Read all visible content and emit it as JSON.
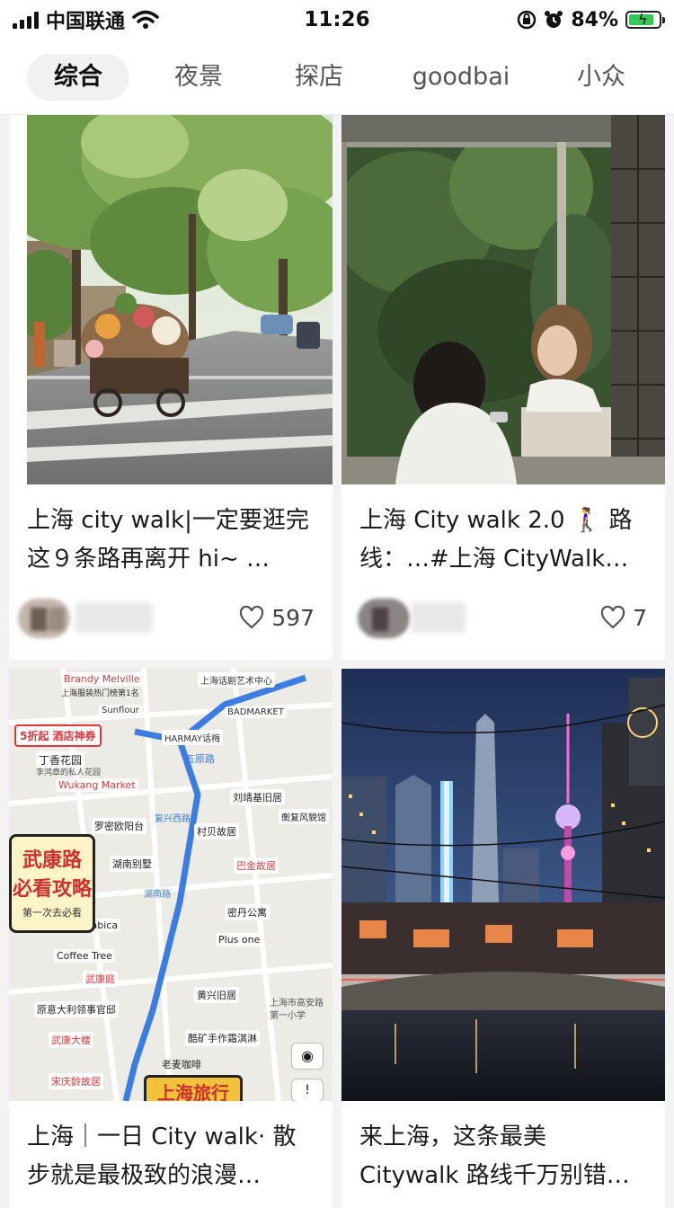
{
  "status_bar": {
    "carrier": "中国联通",
    "time": "11:26",
    "battery_percent": "84%",
    "battery_level": 0.84
  },
  "tabs": [
    {
      "label": "综合",
      "active": true
    },
    {
      "label": "夜景",
      "active": false
    },
    {
      "label": "探店",
      "active": false
    },
    {
      "label": "goodbai",
      "active": false
    },
    {
      "label": "小众",
      "active": false
    }
  ],
  "feed": [
    {
      "title": "上海 city walk|一定要逛完这９条路再离开 hi~ …",
      "likes": "597",
      "image": "tree-lined street with flower cart"
    },
    {
      "title": "上海 City walk 2.0 🚶‍♀️ 路线：…#上海 CityWalk…",
      "likes": "7",
      "image": "two girls by window"
    },
    {
      "title": "上海｜一日 City walk· 散步就是最极致的浪漫…",
      "likes": "",
      "image": "city walk map guide"
    },
    {
      "title": "来上海，这条最美 Citywalk 路线千万别错…",
      "likes": "",
      "image": "Shanghai night skyline"
    }
  ],
  "map_card": {
    "poster_line1": "武康路",
    "poster_line2": "必看攻略",
    "poster_sub": "第一次去必看",
    "coupon": "5折起 酒店神券",
    "bottom_banner": "上海旅行",
    "labels": [
      "Brandy Melville",
      "上海服装热门榜第1名",
      "上海话剧艺术中心",
      "Sunflour",
      "BADMARKET",
      "HARMAY话梅",
      "丁香花园",
      "李鸿章的私人花园",
      "Wukang Market",
      "刘靖基旧居",
      "罗密欧阳台",
      "村贝故居",
      "衡复风貌馆",
      "湖南别墅",
      "巴金故居",
      "密丹公寓",
      "%Arabica",
      "Plus one",
      "Coffee Tree",
      "武康庭",
      "黄兴旧居",
      "原意大利领事官邸",
      "酷矿手作霜淇淋",
      "武康大楼",
      "宋庆龄故居",
      "老麦咖啡",
      "五原路",
      "复兴西路",
      "湖南路",
      "上海市高安路第一小学"
    ],
    "icons": [
      "eye-icon",
      "message-icon"
    ]
  }
}
